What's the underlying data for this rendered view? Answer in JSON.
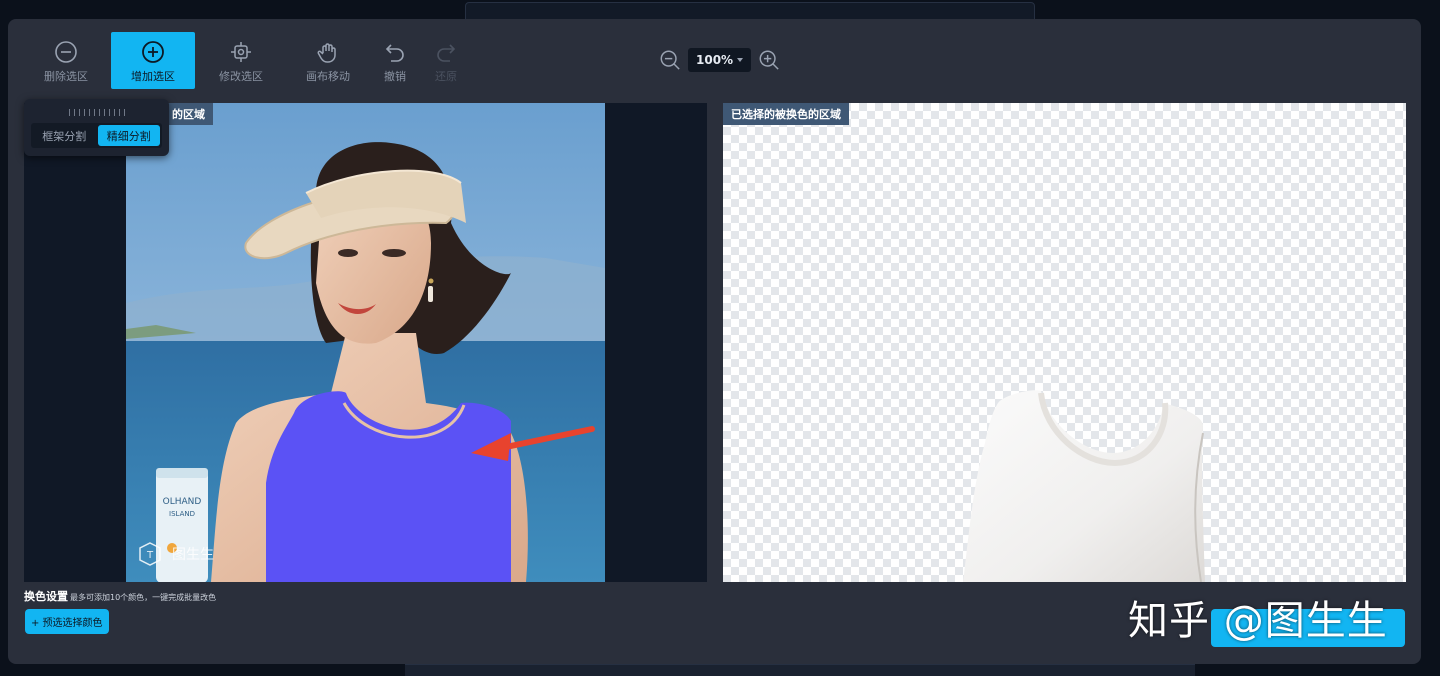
{
  "toolbar": {
    "remove_selection": "删除选区",
    "add_selection": "增加选区",
    "edit_selection": "修改选区",
    "pan_canvas": "画布移动",
    "undo": "撤销",
    "redo": "还原"
  },
  "zoom": {
    "value": "100%"
  },
  "segmentation": {
    "box": "框架分割",
    "fine": "精细分割",
    "active": "fine"
  },
  "left_panel": {
    "tag": "的区域"
  },
  "right_panel": {
    "tag": "已选择的被换色的区域"
  },
  "settings": {
    "title": "换色设置",
    "subtitle": "最多可添加10个颜色，一键完成批量改色",
    "preset_button": "+ 预选选择颜色"
  },
  "photo": {
    "product_text_1": "OLHAND",
    "product_text_2": "ISLAND",
    "logo_text": "图生生"
  },
  "watermark": "知乎 @图生生",
  "colors": {
    "accent": "#12b5f2",
    "selection_overlay": "#5b52f5",
    "tag_bg": "#3f5875"
  }
}
